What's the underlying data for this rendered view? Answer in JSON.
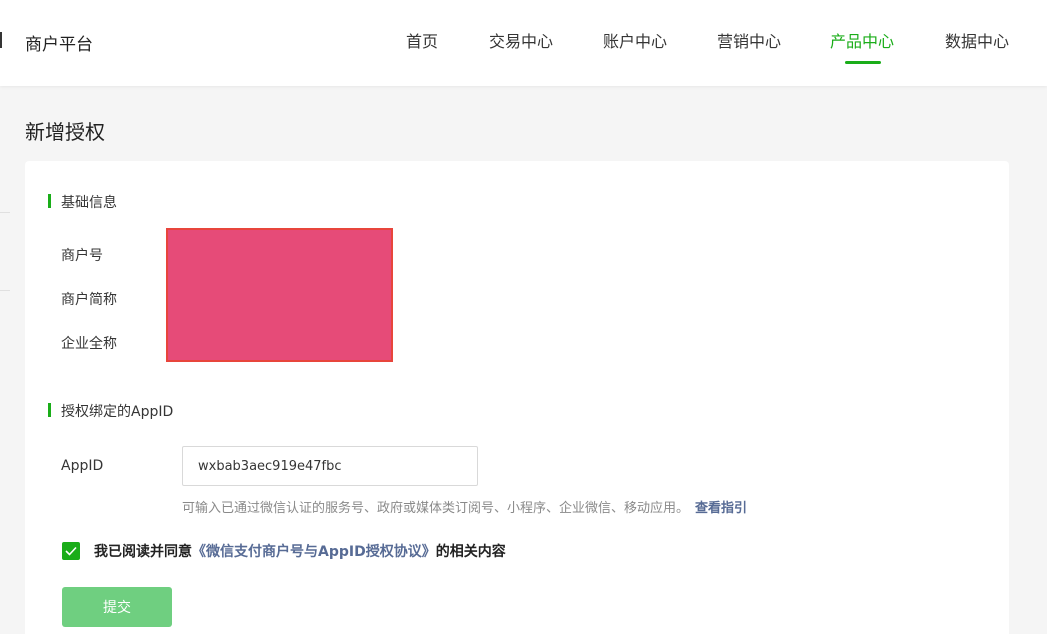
{
  "header": {
    "brand": "商户平台",
    "nav": [
      {
        "label": "首页",
        "active": false
      },
      {
        "label": "交易中心",
        "active": false
      },
      {
        "label": "账户中心",
        "active": false
      },
      {
        "label": "营销中心",
        "active": false
      },
      {
        "label": "产品中心",
        "active": true
      },
      {
        "label": "数据中心",
        "active": false
      }
    ]
  },
  "page": {
    "title": "新增授权"
  },
  "basic_info": {
    "section_title": "基础信息",
    "labels": {
      "merchant_id": "商户号",
      "merchant_short_name": "商户简称",
      "company_full_name": "企业全称"
    }
  },
  "appid_section": {
    "section_title": "授权绑定的AppID",
    "label": "AppID",
    "value": "wxbab3aec919e47fbc",
    "hint": "可输入已通过微信认证的服务号、政府或媒体类订阅号、小程序、企业微信、移动应用。",
    "hint_link": "查看指引"
  },
  "agreement": {
    "checked": true,
    "prefix": "我已阅读并同意",
    "link": "《微信支付商户号与AppID授权协议》",
    "suffix": "的相关内容"
  },
  "submit_label": "提交",
  "colors": {
    "accent": "#1aad19",
    "link": "#576b95",
    "button": "#6fcf80",
    "redaction": "#e64b78"
  }
}
